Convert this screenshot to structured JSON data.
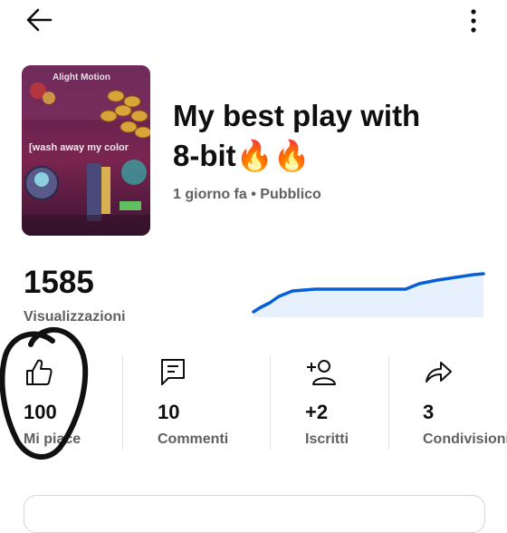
{
  "video": {
    "title_line1": "My best play with",
    "title_line2": "8-bit🔥🔥",
    "meta": "1 giorno fa • Pubblico",
    "thumbnail": {
      "watermark": "Alight Motion",
      "caption": "[wash away my color"
    }
  },
  "views": {
    "count": "1585",
    "label": "Visualizzazioni",
    "trend_color": "#065fd4"
  },
  "stats": [
    {
      "icon": "thumbs-up-icon",
      "value": "100",
      "label": "Mi piace"
    },
    {
      "icon": "comment-icon",
      "value": "10",
      "label": "Commenti"
    },
    {
      "icon": "add-subscriber-icon",
      "value": "+2",
      "label": "Iscritti"
    },
    {
      "icon": "share-icon",
      "value": "3",
      "label": "Condivisioni"
    }
  ],
  "icons": {
    "back": "arrow-left-icon",
    "more": "more-vertical-icon"
  }
}
